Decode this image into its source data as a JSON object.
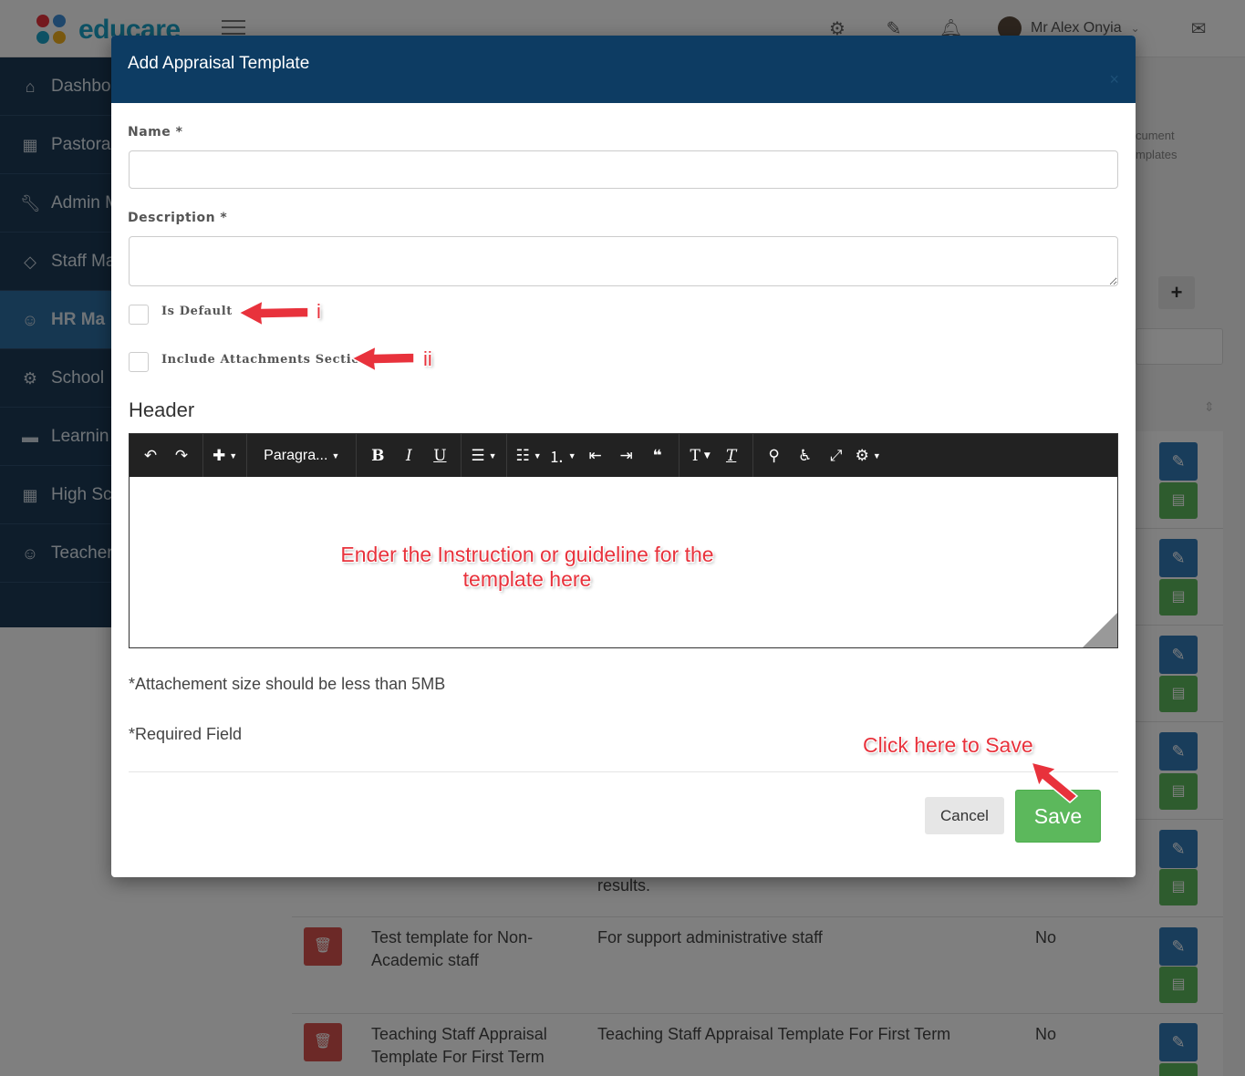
{
  "app": {
    "brand": "educare",
    "user_name": "Mr Alex Onyia"
  },
  "sidebar": {
    "items": [
      {
        "label": "Dashbo",
        "icon": "home-icon"
      },
      {
        "label": "Pastora",
        "icon": "table-icon"
      },
      {
        "label": "Admin M",
        "icon": "wrench-icon"
      },
      {
        "label": "Staff Ma",
        "icon": "diamond-icon"
      },
      {
        "label": "HR Ma",
        "icon": "user-icon"
      },
      {
        "label": "School",
        "icon": "gear-icon"
      },
      {
        "label": "Learnin",
        "icon": "folder-icon"
      },
      {
        "label": "High Sc",
        "icon": "table-icon"
      },
      {
        "label": "Teacher",
        "icon": "user-icon"
      }
    ]
  },
  "background": {
    "right_text_1": "cument",
    "right_text_2": "mplates",
    "rows": [
      {
        "partial_text": "results."
      },
      {
        "name": "Test template for Non-Academic staff",
        "name_line1": "Test template for Non-",
        "name_line2": "Academic staff",
        "description": "For support administrative staff",
        "default": "No"
      },
      {
        "name": "Teaching Staff Appraisal Template For First Term",
        "name_line1": "Teaching Staff Appraisal",
        "name_line2": "Template For First Term",
        "description": "Teaching Staff Appraisal Template For First Term",
        "default": "No"
      }
    ]
  },
  "modal": {
    "title": "Add Appraisal Template",
    "close": "×",
    "name_label": "Name *",
    "name_value": "",
    "description_label": "Description *",
    "description_value": "",
    "is_default_label": "Is Default",
    "include_attachments_label": "Include Attachments Section",
    "header_section": "Header",
    "editor": {
      "paragraph_label": "Paragra...",
      "content": ""
    },
    "attachment_note": "*Attachement size should be less than 5MB",
    "required_note": "*Required Field",
    "cancel_label": "Cancel",
    "save_label": "Save"
  },
  "annotations": {
    "marker_i": "i",
    "marker_ii": "ii",
    "editor_hint_line1": "Ender the Instruction or guideline for the",
    "editor_hint_line2": "template here",
    "save_hint": "Click here to Save",
    "color": "#e8323c"
  },
  "colors": {
    "modal_header": "#0d3c63",
    "sidebar": "#1d3b57",
    "sidebar_active": "#2d6ea3",
    "save": "#5cb85c",
    "edit": "#337ab7",
    "delete": "#d9534f"
  }
}
